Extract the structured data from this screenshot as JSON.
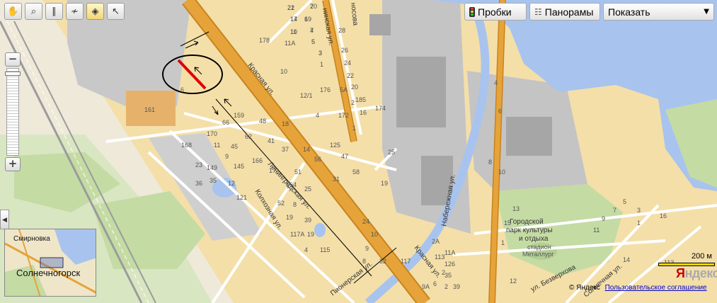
{
  "toolbar": {
    "tools": [
      {
        "name": "hand-tool",
        "icon": "hand-icon",
        "glyph": "✋",
        "active": false
      },
      {
        "name": "magnifier-tool",
        "icon": "magnifier-icon",
        "glyph": "⌕",
        "active": false
      },
      {
        "name": "ruler-tool",
        "icon": "ruler-icon",
        "glyph": "∥",
        "active": false
      },
      {
        "name": "route-tool",
        "icon": "route-icon",
        "glyph": "≁",
        "active": false
      },
      {
        "name": "placemark-tool",
        "icon": "placemark-icon",
        "glyph": "◈",
        "active": true
      },
      {
        "name": "select-tool",
        "icon": "cursor-icon",
        "glyph": "↖",
        "active": false
      }
    ]
  },
  "layers": {
    "traffic_label": "Пробки",
    "traffic_icon": "traffic-light-icon",
    "panoramas_label": "Панорамы",
    "panoramas_icon": "panorama-icon",
    "show_label": "Показать",
    "dropdown_icon": "dropdown-arrow-icon"
  },
  "zoom": {
    "plus_label": "+",
    "minus_label": "−",
    "level_fraction": 0.97
  },
  "minimap": {
    "town_label": "Солнечногорск",
    "village_label": "Смирновка"
  },
  "scale": {
    "label": "200 м"
  },
  "brand": {
    "logo_first": "Я",
    "logo_rest": "ндекс"
  },
  "copyright": {
    "text": "© Яндекс",
    "agreement_link": "Пользовательское соглашение"
  },
  "colors": {
    "land": "#f4dfa9",
    "water": "#a8c4ee",
    "park": "#c4dba4",
    "major_road": "#e6a33a",
    "industrial": "#bebebe",
    "buildings": "#e3c890",
    "highlight": "#e00000"
  },
  "map": {
    "streets": {
      "krasnaya_1": "Красная ул.",
      "krasnaya_2": "Красная ул.",
      "leningradskaya": "Ленинградская ул.",
      "kolkhoznaya": "Колхозная ул.",
      "pionerskaya": "Пионерская ул.",
      "naberezhnaya": "Набережная ул.",
      "bezverkhova": "ул. Безверхова",
      "solnechnaya": "Солнечная ул.",
      "top_street_1": "нинская ул.",
      "top_street_2": "носова"
    },
    "park_label": "Городской\nпарк культуры\nи отдыха",
    "stadium_label": "стадион\nМеталлург",
    "house_numbers": [
      "22",
      "14",
      "11",
      "20",
      "19",
      "7",
      "5",
      "3",
      "1",
      "178",
      "11А",
      "28",
      "26",
      "24",
      "22",
      "20",
      "18",
      "16",
      "10",
      "176",
      "5А",
      "5",
      "12/1",
      "174",
      "4",
      "172",
      "1",
      "2",
      "6",
      "161",
      "159",
      "48",
      "18",
      "125",
      "170",
      "66",
      "45",
      "47",
      "168",
      "23",
      "11",
      "62",
      "41",
      "37",
      "14",
      "149",
      "9",
      "56",
      "58",
      "35",
      "145",
      "166",
      "17",
      "51",
      "31",
      "36",
      "12",
      "121",
      "164",
      "25",
      "52",
      "8",
      "24",
      "19",
      "39",
      "10",
      "117А",
      "19",
      "9",
      "4",
      "115",
      "32",
      "8",
      "117",
      "9А",
      "6",
      "113",
      "2А",
      "113",
      "11А",
      "126",
      "35",
      "2",
      "1",
      "15",
      "13",
      "11",
      "9",
      "7",
      "5",
      "3",
      "1",
      "16",
      "14",
      "12",
      "10",
      "8",
      "6",
      "4",
      "2",
      "39",
      "25",
      "19",
      "21",
      "17",
      "10",
      "7",
      "6",
      "4",
      "5",
      "3"
    ]
  }
}
